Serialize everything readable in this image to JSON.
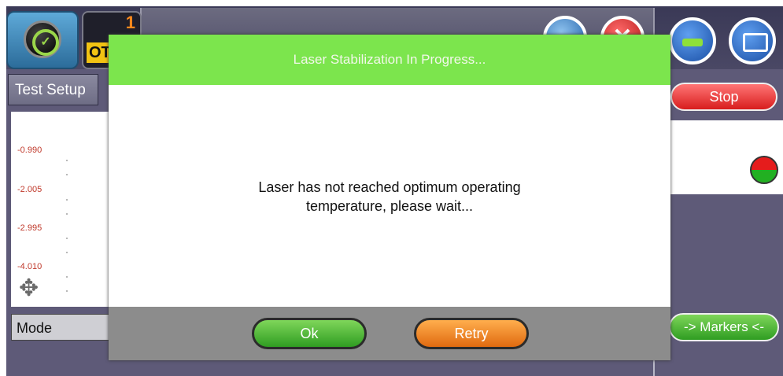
{
  "top_bar": {
    "ot_counter": "1",
    "ot_label": "OT"
  },
  "left_panel": {
    "tab_test_setup": "Test Setup",
    "y_ticks": [
      "-0.990",
      "-2.005",
      "-2.995",
      "-4.010"
    ],
    "mode_label": "Mode"
  },
  "right_panel": {
    "stop_label": "Stop",
    "markers_label": "-> Markers <-"
  },
  "dialog": {
    "title": "Laser Stabilization In Progress...",
    "message_line1": "Laser has not reached optimum operating",
    "message_line2": "temperature, please wait...",
    "ok_label": "Ok",
    "retry_label": "Retry"
  },
  "colors": {
    "dialog_header": "#7ce54d",
    "stop_button": "#d81d1d",
    "ok_button": "#2f9d22",
    "retry_button": "#e06a10",
    "tick_label": "#c0392b"
  },
  "icons": [
    "app-logo-icon",
    "back-icon",
    "close-icon",
    "minimize-icon",
    "folder-icon",
    "move-icon",
    "status-led-icon"
  ]
}
